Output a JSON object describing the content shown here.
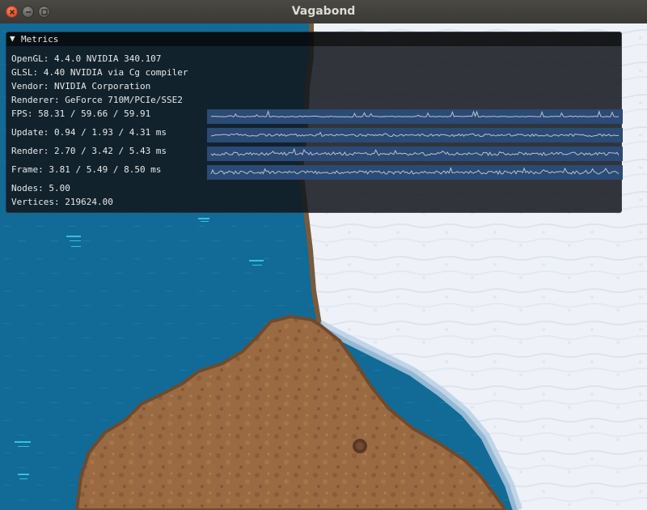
{
  "window": {
    "title": "Vagabond"
  },
  "metrics": {
    "header": "Metrics",
    "opengl": "OpenGL: 4.4.0 NVIDIA 340.107",
    "glsl": "GLSL: 4.40 NVIDIA via Cg compiler",
    "vendor": "Vendor: NVIDIA Corporation",
    "renderer": "Renderer: GeForce 710M/PCIe/SSE2",
    "fps": "FPS: 58.31 / 59.66 / 59.91",
    "update": "Update: 0.94 / 1.93 / 4.31 ms",
    "render": "Render: 2.70 / 3.42 / 5.43 ms",
    "frame": "Frame: 3.81 / 5.49 / 8.50 ms",
    "nodes": "Nodes: 5.00",
    "vertices": "Vertices: 219624.00"
  },
  "colors": {
    "water": "#126a96",
    "snow": "#eef2f8",
    "dirt": "#9a6a42",
    "graph_bg": "#2b4a75",
    "graph_line": "#b9c2cc"
  },
  "icons": [
    "close-icon",
    "minimize-icon",
    "maximize-icon",
    "collapse-triangle-icon"
  ]
}
